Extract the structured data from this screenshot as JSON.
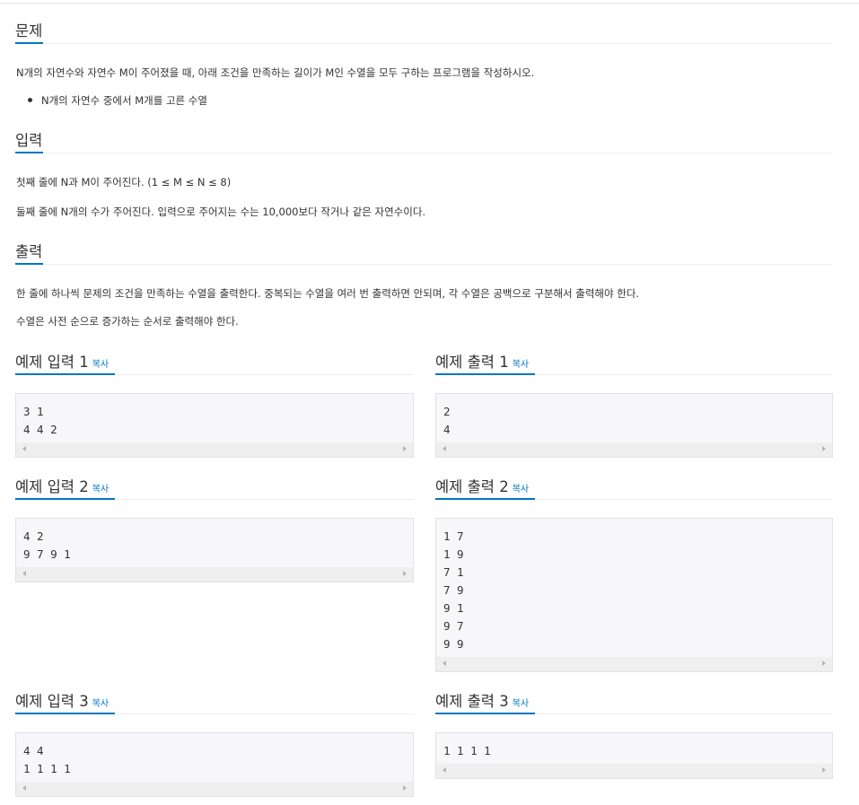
{
  "problem": {
    "title": "문제",
    "description": "N개의 자연수와 자연수 M이 주어졌을 때, 아래 조건을 만족하는 길이가 M인 수열을 모두 구하는 프로그램을 작성하시오.",
    "conditions": [
      "N개의 자연수 중에서 M개를 고른 수열"
    ]
  },
  "input": {
    "title": "입력",
    "lines": [
      "첫째 줄에 N과 M이 주어진다. (1 ≤ M ≤ N ≤ 8)",
      "둘째 줄에 N개의 수가 주어진다. 입력으로 주어지는 수는 10,000보다 작거나 같은 자연수이다."
    ]
  },
  "output": {
    "title": "출력",
    "lines": [
      "한 줄에 하나씩 문제의 조건을 만족하는 수열을 출력한다. 중복되는 수열을 여러 번 출력하면 안되며, 각 수열은 공백으로 구분해서 출력해야 한다.",
      "수열은 사전 순으로 증가하는 순서로 출력해야 한다."
    ]
  },
  "copy_label": "복사",
  "samples": [
    {
      "input_title": "예제 입력 1",
      "output_title": "예제 출력 1",
      "input": [
        "3 1",
        "4 4 2"
      ],
      "output": [
        "2",
        "4"
      ]
    },
    {
      "input_title": "예제 입력 2",
      "output_title": "예제 출력 2",
      "input": [
        "4 2",
        "9 7 9 1"
      ],
      "output": [
        "1 7",
        "1 9",
        "7 1",
        "7 9",
        "9 1",
        "9 7",
        "9 9"
      ]
    },
    {
      "input_title": "예제 입력 3",
      "output_title": "예제 출력 3",
      "input": [
        "4 4",
        "1 1 1 1"
      ],
      "output": [
        "1 1 1 1"
      ]
    }
  ],
  "colors": {
    "accent": "#0076c0",
    "code_bg": "#f7f7f9",
    "rule": "#eeeeee"
  }
}
